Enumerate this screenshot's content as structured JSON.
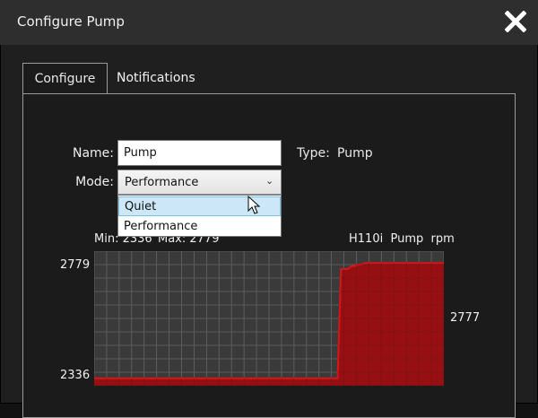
{
  "dialog": {
    "title": "Configure Pump",
    "close_icon": "close-icon"
  },
  "tabs": [
    {
      "label": "Configure",
      "active": true
    },
    {
      "label": "Notifications",
      "active": false
    }
  ],
  "form": {
    "name_label": "Name:",
    "name_value": "Pump",
    "type_label": "Type:",
    "type_value": "Pump",
    "mode_label": "Mode:",
    "mode_value": "Performance",
    "mode_options": [
      "Quiet",
      "Performance"
    ],
    "highlighted_option": "Quiet"
  },
  "chart_header": {
    "min_text": "Min: 2336",
    "max_text": "Max: 2779",
    "series_label": "H110i  Pump  rpm"
  },
  "colors": {
    "fill": "#9e0c0f",
    "line": "#d81418",
    "grid": "#7a7a7a",
    "plot_bg": "#3a3a3a",
    "highlight": "#cce8f8"
  },
  "chart_data": {
    "type": "area",
    "title": "",
    "ylabel": "rpm",
    "ylim": [
      2336,
      2779
    ],
    "y_tick_labels": [
      "2779",
      "2336"
    ],
    "current_value_label": "2777",
    "grid": true,
    "series": [
      {
        "name": "H110i Pump rpm",
        "values": [
          2360,
          2360,
          2360,
          2360,
          2360,
          2360,
          2360,
          2360,
          2360,
          2360,
          2360,
          2360,
          2360,
          2360,
          2360,
          2360,
          2360,
          2360,
          2360,
          2360,
          2360,
          2360,
          2360,
          2360,
          2360,
          2360,
          2360,
          2360,
          2360,
          2360,
          2360,
          2360,
          2360,
          2360,
          2360,
          2360,
          2360,
          2360,
          2360,
          2360,
          2360,
          2360,
          2360,
          2360,
          2360,
          2360,
          2360,
          2360,
          2360,
          2360,
          2360,
          2360,
          2360,
          2360,
          2360,
          2360,
          2360,
          2360,
          2360,
          2360,
          2360,
          2360,
          2360,
          2360,
          2360,
          2360,
          2360,
          2360,
          2360,
          2360,
          2360,
          2360,
          2720,
          2720,
          2720,
          2730,
          2730,
          2735,
          2735,
          2740,
          2740,
          2740,
          2740,
          2740,
          2740,
          2740,
          2740,
          2740,
          2740,
          2740,
          2740,
          2740,
          2740,
          2740,
          2740,
          2740,
          2740,
          2740,
          2740,
          2740,
          2740,
          2740,
          2740
        ]
      }
    ]
  }
}
